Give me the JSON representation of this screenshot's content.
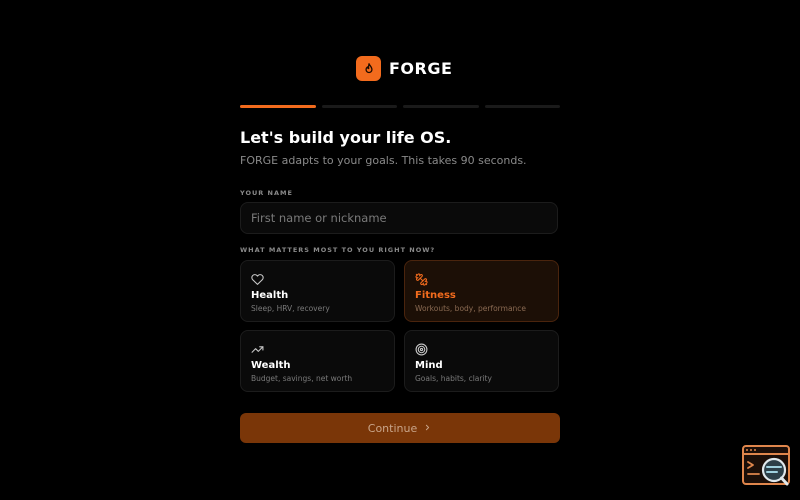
{
  "brand": {
    "name": "FORGE",
    "logo_icon": "flame-icon",
    "accent": "#f26b1d"
  },
  "progress": {
    "current_step": 1,
    "total_steps": 4
  },
  "header": {
    "title": "Let's build your life OS.",
    "subtitle": "FORGE adapts to your goals. This takes 90 seconds."
  },
  "name_field": {
    "label": "YOUR NAME",
    "placeholder": "First name or nickname",
    "value": ""
  },
  "goals": {
    "label": "WHAT MATTERS MOST TO YOU RIGHT NOW?",
    "options": [
      {
        "title": "Health",
        "description": "Sleep, HRV, recovery",
        "icon": "heart-icon",
        "selected": false
      },
      {
        "title": "Fitness",
        "description": "Workouts, body, performance",
        "icon": "dumbbell-icon",
        "selected": true
      },
      {
        "title": "Wealth",
        "description": "Budget, savings, net worth",
        "icon": "trending-up-icon",
        "selected": false
      },
      {
        "title": "Mind",
        "description": "Goals, habits, clarity",
        "icon": "target-icon",
        "selected": false
      }
    ]
  },
  "continue_button": {
    "label": "Continue",
    "icon": "chevron-right-icon"
  },
  "corner_widget": {
    "icon": "code-search-icon"
  }
}
